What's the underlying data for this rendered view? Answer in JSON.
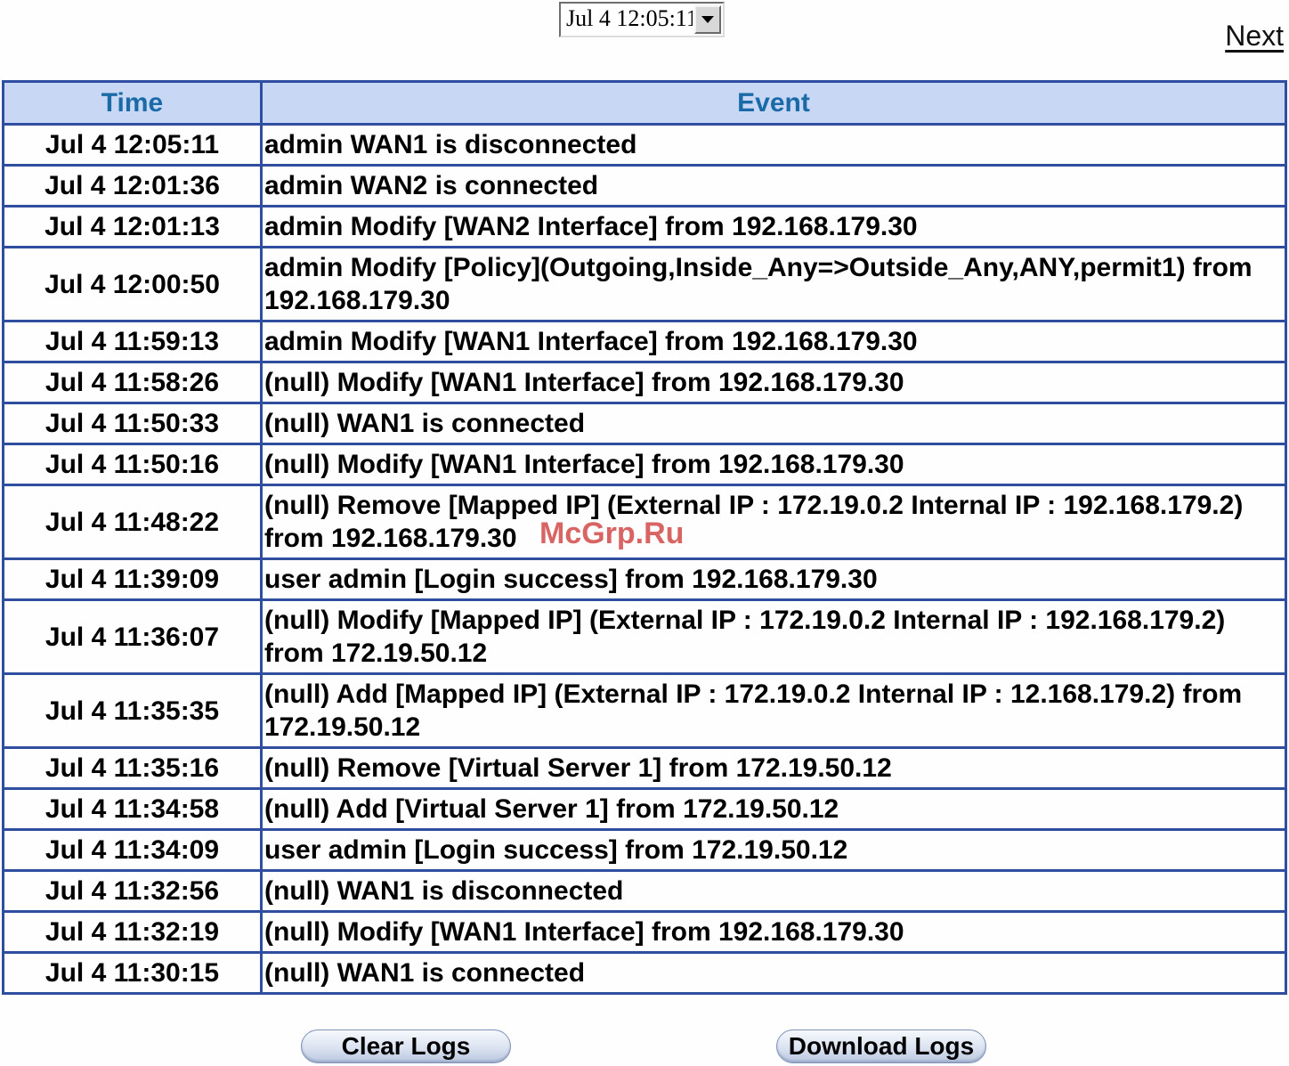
{
  "filter": {
    "selected_time": "Jul 4 12:05:11"
  },
  "nav": {
    "next_label": "Next"
  },
  "table": {
    "headers": {
      "time": "Time",
      "event": "Event"
    },
    "rows": [
      {
        "time": "Jul 4 12:05:11",
        "event": "admin WAN1 is disconnected"
      },
      {
        "time": "Jul 4 12:01:36",
        "event": "admin WAN2 is connected"
      },
      {
        "time": "Jul 4 12:01:13",
        "event": "admin Modify [WAN2 Interface] from 192.168.179.30"
      },
      {
        "time": "Jul 4 12:00:50",
        "event": "admin Modify [Policy](Outgoing,Inside_Any=>Outside_Any,ANY,permit1) from 192.168.179.30"
      },
      {
        "time": "Jul 4 11:59:13",
        "event": "admin Modify [WAN1 Interface] from 192.168.179.30"
      },
      {
        "time": "Jul 4 11:58:26",
        "event": "(null) Modify [WAN1 Interface] from 192.168.179.30"
      },
      {
        "time": "Jul 4 11:50:33",
        "event": "(null) WAN1 is connected"
      },
      {
        "time": "Jul 4 11:50:16",
        "event": "(null) Modify [WAN1 Interface] from 192.168.179.30"
      },
      {
        "time": "Jul 4 11:48:22",
        "event": "(null) Remove [Mapped IP] (External IP : 172.19.0.2 Internal IP : 192.168.179.2) from 192.168.179.30"
      },
      {
        "time": "Jul 4 11:39:09",
        "event": "user admin [Login success] from 192.168.179.30"
      },
      {
        "time": "Jul 4 11:36:07",
        "event": "(null) Modify [Mapped IP] (External IP : 172.19.0.2 Internal IP : 192.168.179.2) from 172.19.50.12"
      },
      {
        "time": "Jul 4 11:35:35",
        "event": "(null) Add [Mapped IP] (External IP : 172.19.0.2 Internal IP : 12.168.179.2) from 172.19.50.12"
      },
      {
        "time": "Jul 4 11:35:16",
        "event": "(null) Remove [Virtual Server 1] from 172.19.50.12"
      },
      {
        "time": "Jul 4 11:34:58",
        "event": "(null) Add [Virtual Server 1] from 172.19.50.12"
      },
      {
        "time": "Jul 4 11:34:09",
        "event": "user admin [Login success] from 172.19.50.12"
      },
      {
        "time": "Jul 4 11:32:56",
        "event": "(null) WAN1 is disconnected"
      },
      {
        "time": "Jul 4 11:32:19",
        "event": "(null) Modify [WAN1 Interface] from 192.168.179.30"
      },
      {
        "time": "Jul 4 11:30:15",
        "event": "(null) WAN1 is connected"
      }
    ]
  },
  "actions": {
    "clear_label": "Clear Logs",
    "download_label": "Download Logs"
  },
  "watermark": "McGrp.Ru"
}
